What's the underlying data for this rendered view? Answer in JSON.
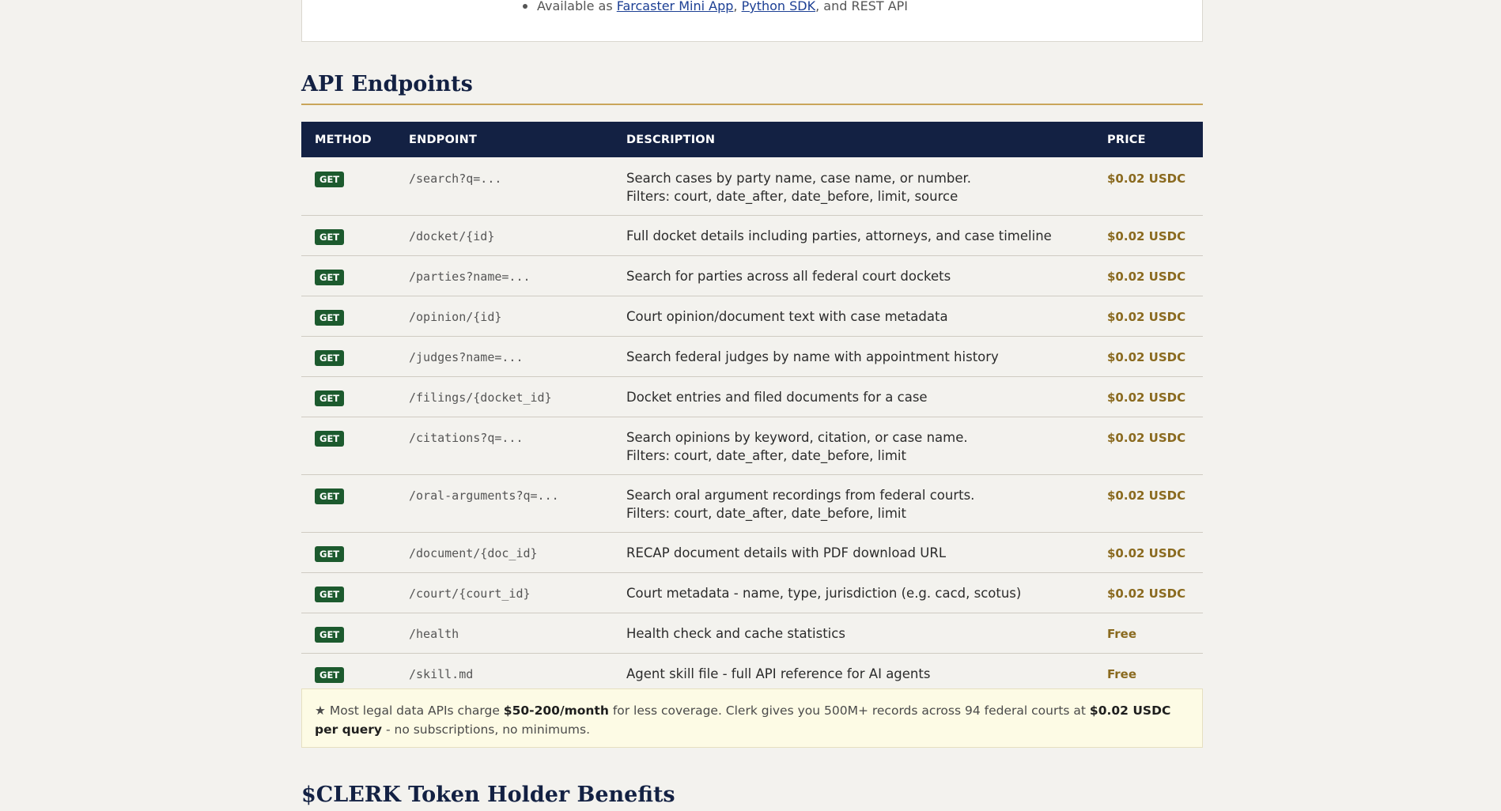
{
  "top_card": {
    "prefix": "Available as ",
    "link1": "Farcaster Mini App",
    "sep1": ", ",
    "link2": "Python SDK",
    "suffix": ", and REST API"
  },
  "api_section": {
    "title": "API Endpoints",
    "columns": [
      "METHOD",
      "ENDPOINT",
      "DESCRIPTION",
      "PRICE"
    ],
    "rows": [
      {
        "method": "GET",
        "endpoint": "/search?q=...",
        "desc": [
          "Search cases by party name, case name, or number.",
          "Filters: court, date_after, date_before, limit, source"
        ],
        "price": "$0.02 USDC"
      },
      {
        "method": "GET",
        "endpoint": "/docket/{id}",
        "desc": [
          "Full docket details including parties, attorneys, and case timeline"
        ],
        "price": "$0.02 USDC"
      },
      {
        "method": "GET",
        "endpoint": "/parties?name=...",
        "desc": [
          "Search for parties across all federal court dockets"
        ],
        "price": "$0.02 USDC"
      },
      {
        "method": "GET",
        "endpoint": "/opinion/{id}",
        "desc": [
          "Court opinion/document text with case metadata"
        ],
        "price": "$0.02 USDC"
      },
      {
        "method": "GET",
        "endpoint": "/judges?name=...",
        "desc": [
          "Search federal judges by name with appointment history"
        ],
        "price": "$0.02 USDC"
      },
      {
        "method": "GET",
        "endpoint": "/filings/{docket_id}",
        "desc": [
          "Docket entries and filed documents for a case"
        ],
        "price": "$0.02 USDC"
      },
      {
        "method": "GET",
        "endpoint": "/citations?q=...",
        "desc": [
          "Search opinions by keyword, citation, or case name.",
          "Filters: court, date_after, date_before, limit"
        ],
        "price": "$0.02 USDC"
      },
      {
        "method": "GET",
        "endpoint": "/oral-arguments?q=...",
        "desc": [
          "Search oral argument recordings from federal courts.",
          "Filters: court, date_after, date_before, limit"
        ],
        "price": "$0.02 USDC"
      },
      {
        "method": "GET",
        "endpoint": "/document/{doc_id}",
        "desc": [
          "RECAP document details with PDF download URL"
        ],
        "price": "$0.02 USDC"
      },
      {
        "method": "GET",
        "endpoint": "/court/{court_id}",
        "desc": [
          "Court metadata - name, type, jurisdiction (e.g. cacd, scotus)"
        ],
        "price": "$0.02 USDC"
      },
      {
        "method": "GET",
        "endpoint": "/health",
        "desc": [
          "Health check and cache statistics"
        ],
        "price": "Free"
      },
      {
        "method": "GET",
        "endpoint": "/skill.md",
        "desc": [
          "Agent skill file - full API reference for AI agents"
        ],
        "price": "Free"
      }
    ]
  },
  "note": {
    "star": "★",
    "t1": " Most legal data APIs charge ",
    "b1": "$50-200/month",
    "t2": " for less coverage. Clerk gives you 500M+ records across 94 federal courts at ",
    "b2": "$0.02 USDC per query",
    "t3": " - no subscriptions, no minimums."
  },
  "token_section": {
    "title": "$CLERK Token Holder Benefits"
  },
  "colors": {
    "header_bg": "#132143",
    "accent_gold": "#c9a55a",
    "badge_green": "#1c5a2e",
    "price_color": "#8a6a1f"
  }
}
